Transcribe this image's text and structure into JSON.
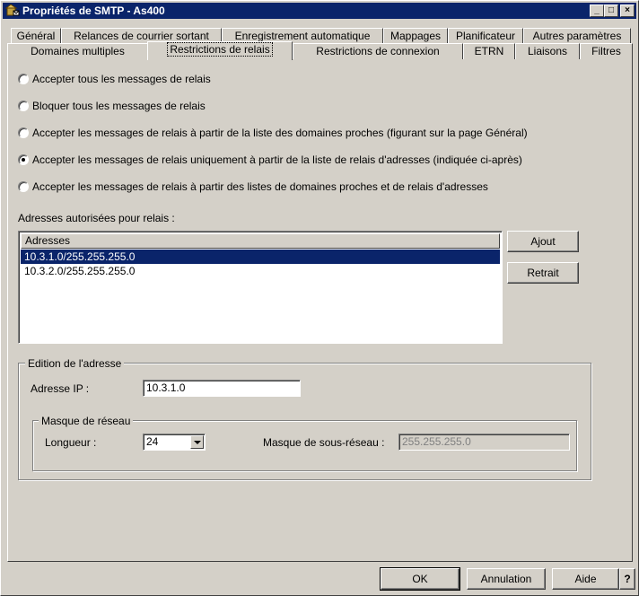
{
  "window": {
    "title": "Propriétés de SMTP - As400",
    "minimize": "_",
    "maximize": "□",
    "close": "×"
  },
  "tabs_back": [
    {
      "label": "Général"
    },
    {
      "label": "Relances de courrier sortant"
    },
    {
      "label": "Enregistrement automatique"
    },
    {
      "label": "Mappages"
    },
    {
      "label": "Planificateur"
    },
    {
      "label": "Autres paramètres"
    }
  ],
  "tabs_front": [
    {
      "label": "Domaines multiples"
    },
    {
      "label": "Restrictions de relais",
      "selected": true
    },
    {
      "label": "Restrictions de connexion"
    },
    {
      "label": "ETRN"
    },
    {
      "label": "Liaisons"
    },
    {
      "label": "Filtres"
    }
  ],
  "relay_options": [
    {
      "label": "Accepter tous les messages de relais",
      "checked": false
    },
    {
      "label": "Bloquer tous les messages de relais",
      "checked": false
    },
    {
      "label": "Accepter les messages de relais à partir de la liste des domaines proches (figurant sur la page Général)",
      "checked": false
    },
    {
      "label": "Accepter les messages de relais uniquement à partir de la liste de relais d'adresses (indiquée ci-après)",
      "checked": true
    },
    {
      "label": "Accepter les messages de relais à partir des listes de domaines proches et de relais d'adresses",
      "checked": false
    }
  ],
  "addresses": {
    "section_label": "Adresses autorisées pour relais :",
    "column_header": "Adresses",
    "rows": [
      "10.3.1.0/255.255.255.0",
      "10.3.2.0/255.255.255.0"
    ],
    "add_button": "Ajout",
    "remove_button": "Retrait"
  },
  "edit": {
    "group_label": "Edition de l'adresse",
    "ip_label": "Adresse IP :",
    "ip_value": "10.3.1.0",
    "mask_group_label": "Masque de réseau",
    "length_label": "Longueur :",
    "length_value": "24",
    "subnet_label": "Masque de sous-réseau :",
    "subnet_value": "255.255.255.0"
  },
  "footer": {
    "ok": "OK",
    "cancel": "Annulation",
    "help": "Aide",
    "help_icon": "?"
  },
  "colors": {
    "face": "#d4d0c8",
    "title_bar": "#0a246a",
    "selection": "#0a246a"
  }
}
